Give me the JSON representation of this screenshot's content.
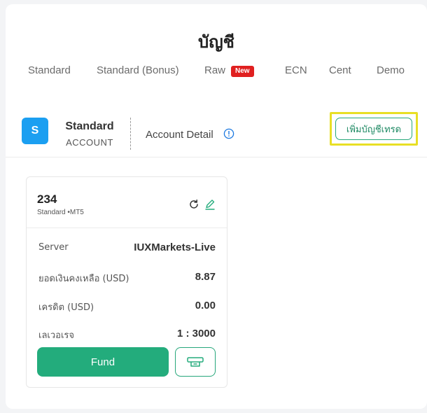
{
  "page": {
    "title": "บัญชี"
  },
  "tabs": [
    {
      "label": "Standard"
    },
    {
      "label": "Standard (Bonus)"
    },
    {
      "label": "Raw",
      "badge": "New"
    },
    {
      "label": "ECN"
    },
    {
      "label": "Cent"
    },
    {
      "label": "Demo"
    }
  ],
  "account_header": {
    "avatar_letter": "S",
    "type": "Standard",
    "subtitle": "ACCOUNT",
    "detail_link": "Account Detail",
    "add_button": "เพิ่มบัญชีเทรด"
  },
  "card": {
    "id": "234",
    "subtitle": "Standard •MT5",
    "rows": [
      {
        "label": "Server",
        "value": "IUXMarkets-Live"
      },
      {
        "label": "ยอดเงินคงเหลือ (USD)",
        "value": "8.87"
      },
      {
        "label": "เครดิต (USD)",
        "value": "0.00"
      },
      {
        "label": "เลเวอเรจ",
        "value": "1 : 3000"
      }
    ],
    "fund_button": "Fund"
  },
  "colors": {
    "accent_green": "#23ac7c",
    "avatar_blue": "#1b9ff1",
    "badge_red": "#e02020",
    "highlight_yellow": "#e8df25"
  },
  "icons": [
    "info-icon",
    "refresh-icon",
    "edit-icon",
    "transfer-icon"
  ]
}
